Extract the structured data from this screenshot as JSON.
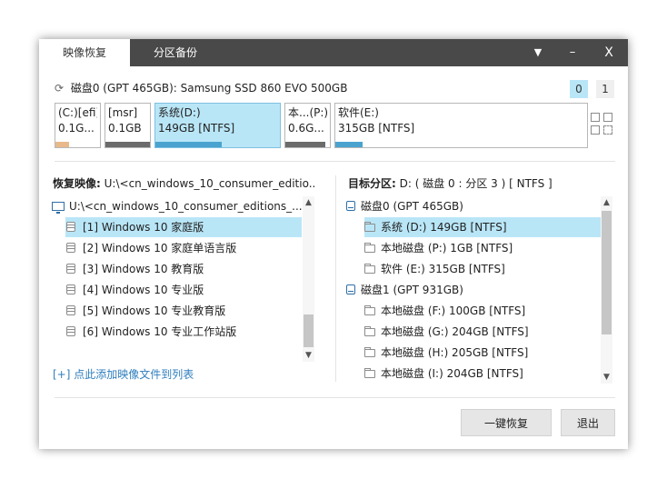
{
  "titlebar": {
    "tabs": [
      {
        "label": "映像恢复",
        "active": true
      },
      {
        "label": "分区备份",
        "active": false
      }
    ],
    "menu_icon": "▼",
    "minimize_icon": "–",
    "close_icon": "X"
  },
  "disk": {
    "header": "磁盘0 (GPT 465GB): Samsung SSD 860 EVO 500GB",
    "badges": [
      "0",
      "1"
    ],
    "partitions": [
      {
        "name": "(C:)[efi]",
        "size": "0.1G...",
        "bar_color": "#e8b98a",
        "usage": 0.3
      },
      {
        "name": "[msr]",
        "size": "0.1GB",
        "bar_color": "#6b6b6b",
        "usage": 1.0
      },
      {
        "name": "系统(D:)",
        "size": "149GB [NTFS]",
        "bar_color": "#4aa3cf",
        "usage": 0.53,
        "selected": true
      },
      {
        "name": "本...(P:)",
        "size": "0.6G...",
        "bar_color": "#6b6b6b",
        "usage": 0.9
      },
      {
        "name": "软件(E:)",
        "size": "315GB [NTFS]",
        "bar_color": "#4aa3cf",
        "usage": 0.11
      }
    ]
  },
  "left_pane": {
    "title_label": "恢复映像:",
    "title_value": "U:\\<cn_windows_10_consumer_editio...",
    "root": "U:\\<cn_windows_10_consumer_editions_...",
    "items": [
      "[1] Windows 10 家庭版",
      "[2] Windows 10 家庭单语言版",
      "[3] Windows 10 教育版",
      "[4] Windows 10 专业版",
      "[5] Windows 10 专业教育版",
      "[6] Windows 10 专业工作站版"
    ],
    "selected_index": 0,
    "add_link": "[+] 点此添加映像文件到列表"
  },
  "right_pane": {
    "title_label": "目标分区:",
    "title_value": "D: ( 磁盘 0 : 分区 3 ) [ NTFS ]",
    "tree": [
      {
        "type": "disk",
        "label": "磁盘0 (GPT 465GB)"
      },
      {
        "type": "part",
        "label": "系统 (D:) 149GB [NTFS]",
        "selected": true
      },
      {
        "type": "part",
        "label": "本地磁盘 (P:) 1GB [NTFS]"
      },
      {
        "type": "part",
        "label": "软件 (E:) 315GB [NTFS]"
      },
      {
        "type": "disk",
        "label": "磁盘1 (GPT 931GB)"
      },
      {
        "type": "part",
        "label": "本地磁盘 (F:) 100GB [NTFS]"
      },
      {
        "type": "part",
        "label": "本地磁盘 (G:) 204GB [NTFS]"
      },
      {
        "type": "part",
        "label": "本地磁盘 (H:) 205GB [NTFS]"
      },
      {
        "type": "part",
        "label": "本地磁盘 (I:) 204GB [NTFS]"
      }
    ]
  },
  "buttons": {
    "restore": "一键恢复",
    "exit": "退出"
  },
  "colors": {
    "titlebar": "#49494a",
    "selection": "#b9e6f7",
    "link": "#2f7ebd"
  }
}
